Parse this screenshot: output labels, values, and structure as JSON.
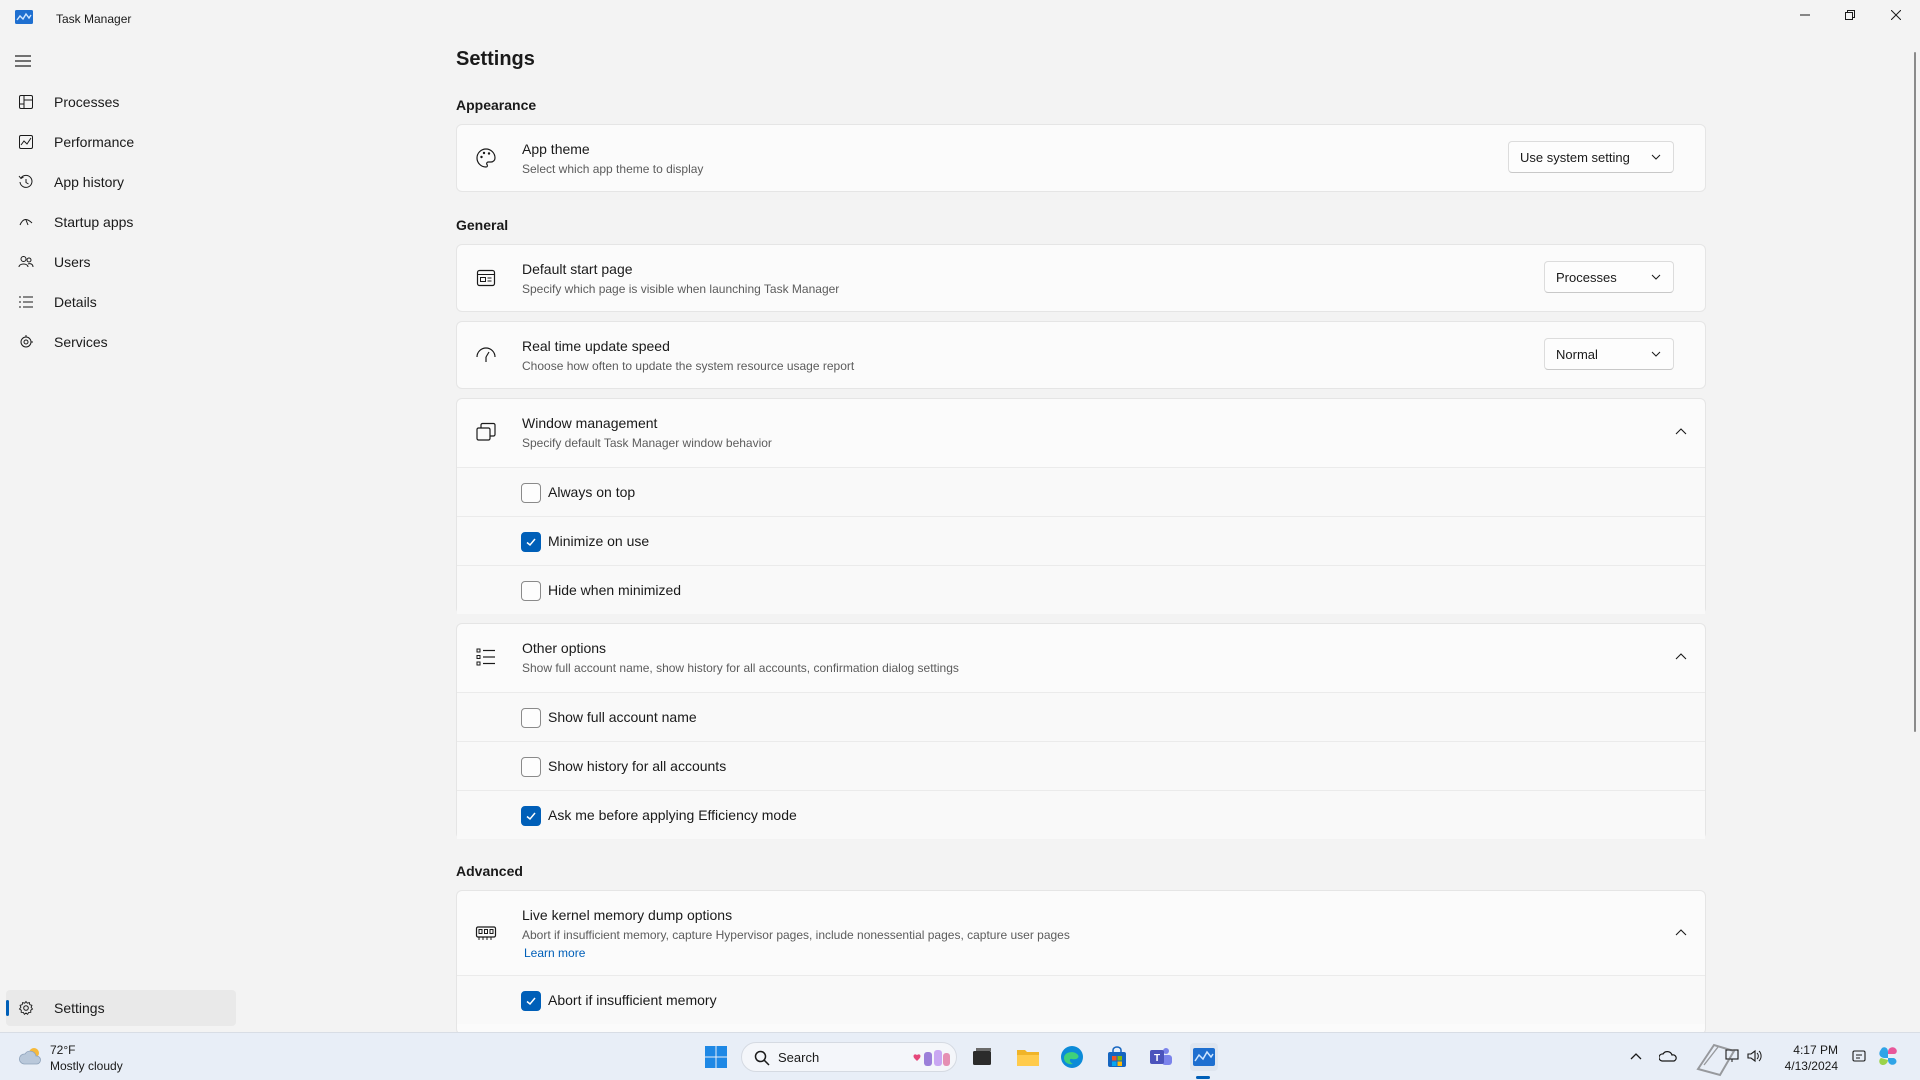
{
  "window": {
    "title": "Task Manager"
  },
  "sidebar": {
    "items": [
      {
        "label": "Processes",
        "icon": "processes-icon"
      },
      {
        "label": "Performance",
        "icon": "performance-icon"
      },
      {
        "label": "App history",
        "icon": "history-icon"
      },
      {
        "label": "Startup apps",
        "icon": "startup-icon"
      },
      {
        "label": "Users",
        "icon": "users-icon"
      },
      {
        "label": "Details",
        "icon": "details-icon"
      },
      {
        "label": "Services",
        "icon": "services-icon"
      }
    ],
    "settings": {
      "label": "Settings",
      "icon": "gear-icon",
      "active": true
    }
  },
  "main": {
    "title": "Settings",
    "sections": {
      "appearance": "Appearance",
      "general": "General",
      "advanced": "Advanced"
    },
    "app_theme": {
      "title": "App theme",
      "desc": "Select which app theme to display",
      "value": "Use system setting"
    },
    "default_start_page": {
      "title": "Default start page",
      "desc": "Specify which page is visible when launching Task Manager",
      "value": "Processes"
    },
    "update_speed": {
      "title": "Real time update speed",
      "desc": "Choose how often to update the system resource usage report",
      "value": "Normal"
    },
    "window_management": {
      "title": "Window management",
      "desc": "Specify default Task Manager window behavior",
      "options": [
        {
          "label": "Always on top",
          "checked": false
        },
        {
          "label": "Minimize on use",
          "checked": true
        },
        {
          "label": "Hide when minimized",
          "checked": false
        }
      ]
    },
    "other_options": {
      "title": "Other options",
      "desc": "Show full account name, show history for all accounts, confirmation dialog settings",
      "options": [
        {
          "label": "Show full account name",
          "checked": false
        },
        {
          "label": "Show history for all accounts",
          "checked": false
        },
        {
          "label": "Ask me before applying Efficiency mode",
          "checked": true
        }
      ]
    },
    "kernel_dump": {
      "title": "Live kernel memory dump options",
      "desc": "Abort if insufficient memory, capture Hypervisor pages, include nonessential pages, capture user pages",
      "link": "Learn more",
      "options": [
        {
          "label": "Abort if insufficient memory",
          "checked": true
        }
      ]
    }
  },
  "taskbar": {
    "weather": {
      "temp": "72°F",
      "condition": "Mostly cloudy"
    },
    "search_label": "Search",
    "clock": {
      "time": "4:17 PM",
      "date": "4/13/2024"
    }
  },
  "colors": {
    "accent": "#005fb8",
    "background": "#f3f3f3",
    "card": "#fbfbfb"
  }
}
